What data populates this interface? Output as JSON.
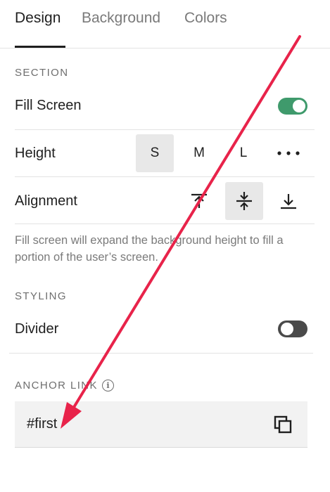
{
  "tabs": [
    {
      "label": "Design",
      "active": true
    },
    {
      "label": "Background",
      "active": false
    },
    {
      "label": "Colors",
      "active": false
    }
  ],
  "section": {
    "heading": "SECTION",
    "fill_screen": {
      "label": "Fill Screen",
      "enabled": true
    },
    "height": {
      "label": "Height",
      "options": [
        "S",
        "M",
        "L"
      ],
      "selected": "S",
      "more_icon": "more-horizontal-icon"
    },
    "alignment": {
      "label": "Alignment",
      "options": [
        "align-top-icon",
        "align-center-icon",
        "align-bottom-icon"
      ],
      "selected": "align-center-icon"
    },
    "help_text": "Fill screen will expand the background height to fill a portion of the user’s screen."
  },
  "styling": {
    "heading": "STYLING",
    "divider": {
      "label": "Divider",
      "enabled": false
    }
  },
  "anchor": {
    "heading": "ANCHOR LINK",
    "info_icon": "info-icon",
    "info_glyph": "i",
    "value": "#first",
    "copy_icon": "copy-icon"
  },
  "colors": {
    "toggle_on": "#3f9a6c",
    "toggle_off": "#4a4a4a",
    "annotation_arrow": "#e8234a"
  }
}
